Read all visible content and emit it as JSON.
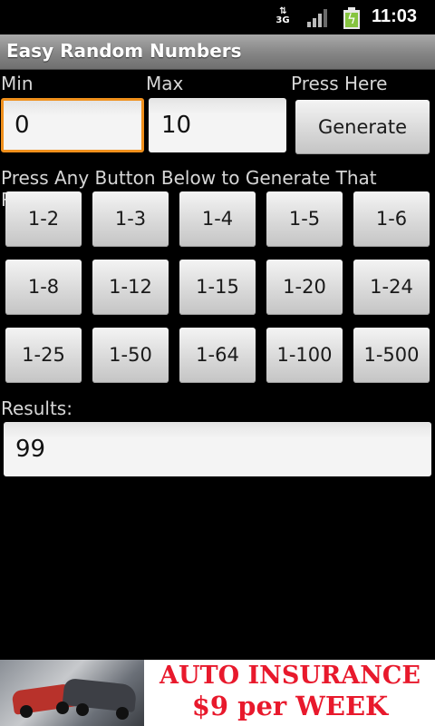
{
  "status_bar": {
    "network": "3G",
    "time": "11:03"
  },
  "app": {
    "title": "Easy Random Numbers"
  },
  "form": {
    "min_label": "Min",
    "min_value": "0",
    "max_label": "Max",
    "max_value": "10",
    "generate_hint": "Press Here",
    "generate_button": "Generate"
  },
  "range_section": {
    "instruction": "Press Any Button Below to Generate That Range",
    "buttons": [
      "1-2",
      "1-3",
      "1-4",
      "1-5",
      "1-6",
      "1-8",
      "1-12",
      "1-15",
      "1-20",
      "1-24",
      "1-25",
      "1-50",
      "1-64",
      "1-100",
      "1-500"
    ]
  },
  "results": {
    "label": "Results:",
    "value": "99"
  },
  "ad": {
    "line1": "AUTO INSURANCE",
    "line2": "$9 per WEEK"
  }
}
